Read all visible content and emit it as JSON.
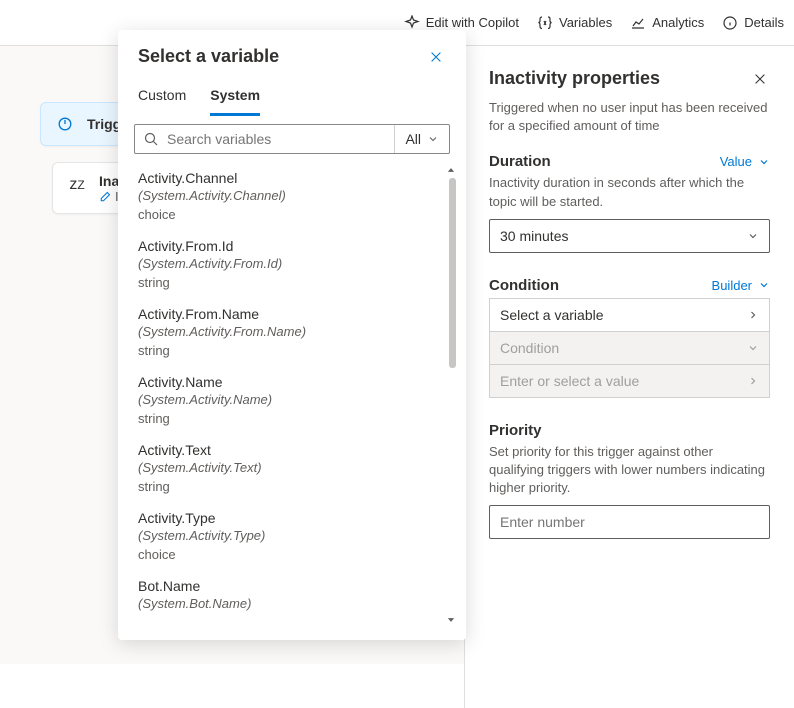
{
  "toolbar": {
    "copilot": "Edit with Copilot",
    "variables": "Variables",
    "analytics": "Analytics",
    "details": "Details"
  },
  "canvas": {
    "trigger_label": "Trigger",
    "inactivity_label": "Inactivity",
    "inactivity_sub": "Inactivity"
  },
  "var_popup": {
    "title": "Select a variable",
    "tab_custom": "Custom",
    "tab_system": "System",
    "search_placeholder": "Search variables",
    "filter_label": "All",
    "items": [
      {
        "name": "Activity.Channel",
        "path": "(System.Activity.Channel)",
        "type": "choice"
      },
      {
        "name": "Activity.From.Id",
        "path": "(System.Activity.From.Id)",
        "type": "string"
      },
      {
        "name": "Activity.From.Name",
        "path": "(System.Activity.From.Name)",
        "type": "string"
      },
      {
        "name": "Activity.Name",
        "path": "(System.Activity.Name)",
        "type": "string"
      },
      {
        "name": "Activity.Text",
        "path": "(System.Activity.Text)",
        "type": "string"
      },
      {
        "name": "Activity.Type",
        "path": "(System.Activity.Type)",
        "type": "choice"
      },
      {
        "name": "Bot.Name",
        "path": "(System.Bot.Name)",
        "type": ""
      }
    ]
  },
  "right_panel": {
    "title": "Inactivity properties",
    "description": "Triggered when no user input has been received for a specified amount of time",
    "duration": {
      "label": "Duration",
      "mode": "Value",
      "help": "Inactivity duration in seconds after which the topic will be started.",
      "value": "30 minutes"
    },
    "condition": {
      "label": "Condition",
      "mode": "Builder",
      "select_variable": "Select a variable",
      "condition_text": "Condition",
      "value_placeholder": "Enter or select a value"
    },
    "priority": {
      "label": "Priority",
      "help": "Set priority for this trigger against other qualifying triggers with lower numbers indicating higher priority.",
      "placeholder": "Enter number"
    }
  }
}
